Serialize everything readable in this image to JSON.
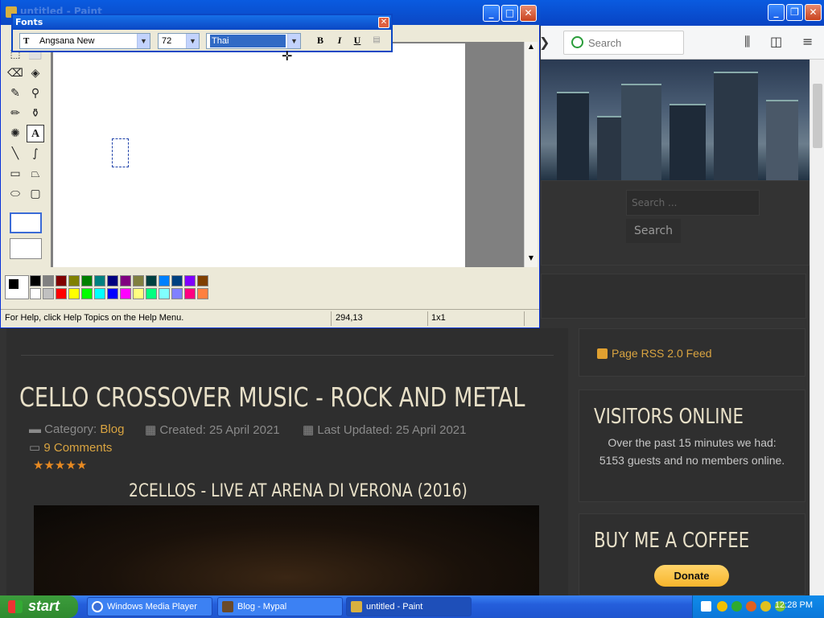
{
  "browser": {
    "search_placeholder": "Search",
    "sidebar_search_placeholder": "Search ...",
    "sidebar_search_button": "Search",
    "toolbar_icons": [
      "library-icon",
      "sidebar-icon",
      "menu-icon"
    ]
  },
  "article": {
    "title": "CELLO CROSSOVER MUSIC - ROCK AND METAL",
    "category_label": "Category:",
    "category": "Blog",
    "created": "Created: 25 April 2021",
    "updated": "Last Updated: 25 April 2021",
    "comments": "9 Comments",
    "rating_stars": 5,
    "video_title": "2CELLOS - LIVE AT ARENA DI VERONA (2016)"
  },
  "sidebar": {
    "rss": "Page RSS 2.0 Feed",
    "visitors_title": "VISITORS ONLINE",
    "visitors_text": "Over the past 15 minutes we had: 5153 guests and no members online.",
    "coffee_title": "BUY ME A COFFEE",
    "donate": "Donate"
  },
  "paint": {
    "title": "untitled - Paint",
    "status_help": "For Help, click Help Topics on the Help Menu.",
    "status_coords": "294,13",
    "status_size": "1x1",
    "palette": [
      "#000000",
      "#808080",
      "#800000",
      "#808000",
      "#008000",
      "#008080",
      "#000080",
      "#800080",
      "#808040",
      "#004040",
      "#0080ff",
      "#004080",
      "#8000ff",
      "#804000",
      "#ffffff",
      "#c0c0c0",
      "#ff0000",
      "#ffff00",
      "#00ff00",
      "#00ffff",
      "#0000ff",
      "#ff00ff",
      "#ffff80",
      "#00ff80",
      "#80ffff",
      "#8080ff",
      "#ff0080",
      "#ff8040"
    ]
  },
  "fonts_toolbar": {
    "title": "Fonts",
    "font_name": "Angsana New",
    "font_size": "72",
    "script": "Thai",
    "bold": "B",
    "italic": "I",
    "underline": "U"
  },
  "taskbar": {
    "start": "start",
    "tasks": [
      {
        "label": "Windows Media Player",
        "active": false
      },
      {
        "label": "Blog - Mypal",
        "active": false
      },
      {
        "label": "untitled - Paint",
        "active": true
      }
    ],
    "clock": "12:28 PM"
  },
  "colors": {
    "xp_blue": "#0b47c4",
    "accent_gold": "#d9a441",
    "star_orange": "#e88a22"
  }
}
